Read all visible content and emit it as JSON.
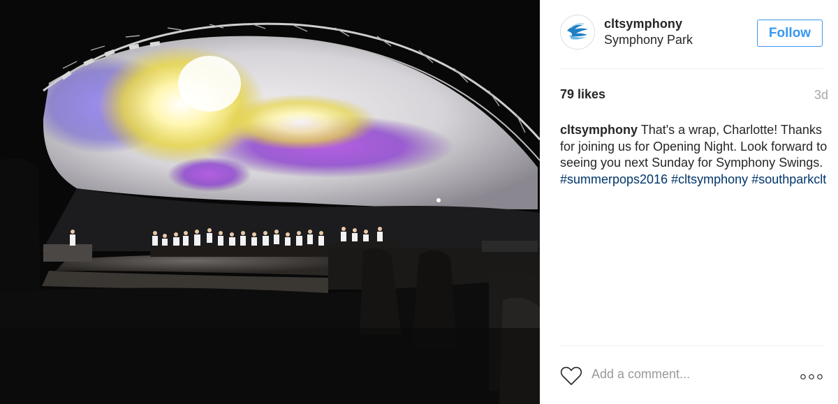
{
  "post": {
    "image_alt": "Orchestra performing on stage under an illuminated outdoor shell at night"
  },
  "header": {
    "username": "cltsymphony",
    "location": "Symphony Park",
    "follow_label": "Follow"
  },
  "stats": {
    "likes": "79 likes",
    "timestamp": "3d"
  },
  "caption": {
    "username": "cltsymphony",
    "text": "That's a wrap, Charlotte! Thanks for joining us for Opening Night. Look forward to seeing you next Sunday for Symphony Swings.",
    "hashtags": [
      "#summerpops2016",
      "#cltsymphony",
      "#southparkclt"
    ]
  },
  "comment": {
    "placeholder": "Add a comment..."
  },
  "icons": {
    "avatar": "symphony-logo-icon",
    "like": "heart-icon",
    "more": "more-options-icon"
  },
  "colors": {
    "follow_blue": "#3897f0",
    "hashtag": "#003569",
    "muted": "#999999"
  }
}
